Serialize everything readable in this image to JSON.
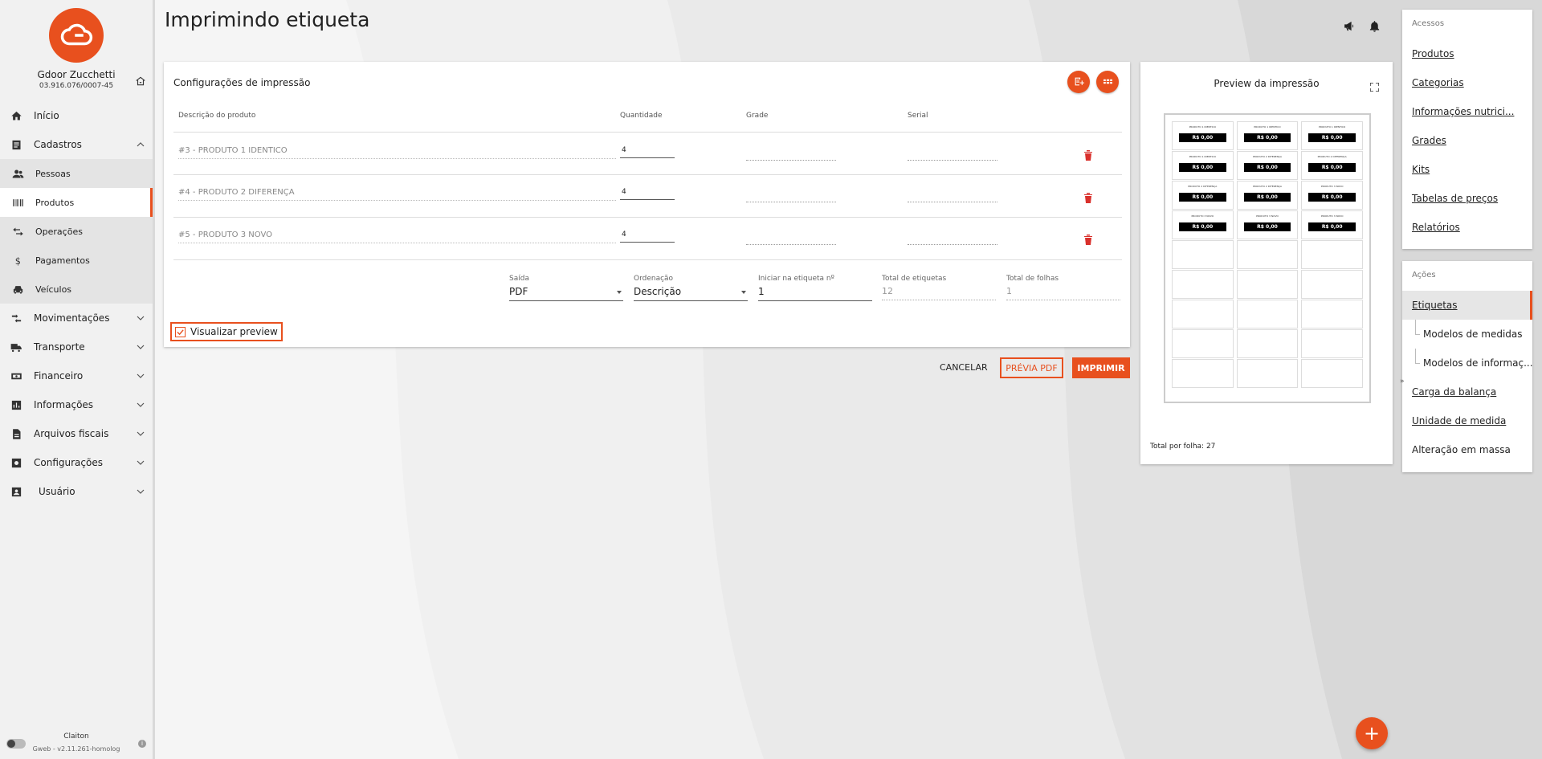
{
  "company": {
    "name": "Gdoor Zucchetti",
    "cnpj": "03.916.076/0007-45"
  },
  "nav": {
    "inicio": "Início",
    "cadastros": "Cadastros",
    "pessoas": "Pessoas",
    "produtos": "Produtos",
    "operacoes": "Operações",
    "pagamentos": "Pagamentos",
    "veiculos": "Veículos",
    "movimentacoes": "Movimentações",
    "transporte": "Transporte",
    "financeiro": "Financeiro",
    "informacoes": "Informações",
    "arquivos": "Arquivos fiscais",
    "configuracoes": "Configurações",
    "usuario": "Usuário"
  },
  "footer": {
    "user": "Claiton",
    "version": "Gweb - v2.11.261-homolog"
  },
  "page": {
    "title": "Imprimindo etiqueta"
  },
  "config": {
    "title": "Configurações de impressão",
    "headers": {
      "descricao": "Descrição do produto",
      "quantidade": "Quantidade",
      "grade": "Grade",
      "serial": "Serial"
    },
    "rows": [
      {
        "produto": "#3 - PRODUTO 1 IDENTICO",
        "quantidade": "4"
      },
      {
        "produto": "#4 - PRODUTO 2 DIFERENÇA",
        "quantidade": "4"
      },
      {
        "produto": "#5 - PRODUTO 3 NOVO",
        "quantidade": "4"
      }
    ],
    "saida": {
      "label": "Saída",
      "value": "PDF"
    },
    "ordenacao": {
      "label": "Ordenação",
      "value": "Descrição"
    },
    "iniciar": {
      "label": "Iniciar na etiqueta nº",
      "value": "1"
    },
    "total_etiquetas": {
      "label": "Total de etiquetas",
      "value": "12"
    },
    "total_folhas": {
      "label": "Total de folhas",
      "value": "1"
    },
    "visualizar_preview": "Visualizar preview"
  },
  "actions": {
    "cancel": "CANCELAR",
    "previa": "PRÉVIA PDF",
    "print": "IMPRIMIR"
  },
  "preview": {
    "title": "Preview da impressão",
    "total": "Total por folha: 27",
    "price": "R$ 0,00",
    "labels": [
      "PRODUTO 1 IDENTICO",
      "PRODUTO 1 IDENTICO",
      "PRODUTO 1 IDENTICO",
      "PRODUTO 1 IDENTICO",
      "PRODUTO 2 DIFERENÇA",
      "PRODUTO 2 DIFERENÇA",
      "PRODUTO 2 DIFERENÇA",
      "PRODUTO 2 DIFERENÇA",
      "PRODUTO 3 NOVO",
      "PRODUTO 3 NOVO",
      "PRODUTO 3 NOVO",
      "PRODUTO 3 NOVO"
    ]
  },
  "access": {
    "title": "Acessos",
    "items": [
      "Produtos",
      "Categorias",
      "Informações nutrici...",
      "Grades",
      "Kits",
      "Tabelas de preços",
      "Relatórios"
    ]
  },
  "acoes": {
    "title": "Ações",
    "items": [
      "Etiquetas",
      "Modelos de medidas",
      "Modelos de informaç...",
      "Carga da balança",
      "Unidade de medida",
      "Alteração em massa"
    ]
  },
  "fab": "+",
  "colors": {
    "accent": "#e8501e",
    "danger": "#d9302c"
  }
}
